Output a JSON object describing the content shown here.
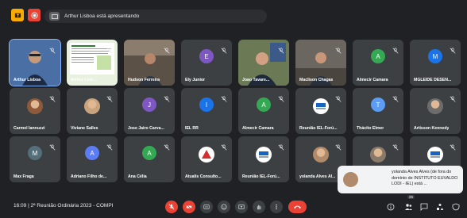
{
  "topbar": {
    "presenting_text": "Arthur Lisboa está apresentando"
  },
  "tiles": [
    {
      "name": "Arthur Lisboa",
      "kind": "video-arthur"
    },
    {
      "name": "Arthur Lisb...",
      "kind": "screen-share"
    },
    {
      "name": "Hudson Ferreira",
      "kind": "video-hudson"
    },
    {
      "name": "Ely Junior",
      "kind": "avatar",
      "letter": "E",
      "color": "#7e57c2"
    },
    {
      "name": "Joao Tavare...",
      "kind": "video-joao"
    },
    {
      "name": "Maclison Chagas",
      "kind": "video-maclison"
    },
    {
      "name": "Almecir Camara",
      "kind": "avatar",
      "letter": "A",
      "color": "#34a853"
    },
    {
      "name": "MGLEIDE DESEN...",
      "kind": "avatar",
      "letter": "M",
      "color": "#1a73e8"
    },
    {
      "name": "Carmel Iannuzzi",
      "kind": "photo",
      "color": "#8d5a3b"
    },
    {
      "name": "Viviane Salles",
      "kind": "photo",
      "color": "#c9a27e"
    },
    {
      "name": "Jose Jairo Carva...",
      "kind": "avatar",
      "letter": "J",
      "color": "#7e57c2"
    },
    {
      "name": "IEL RR",
      "kind": "avatar",
      "letter": "I",
      "color": "#1a73e8"
    },
    {
      "name": "Almecir Camara",
      "kind": "avatar",
      "letter": "A",
      "color": "#34a853"
    },
    {
      "name": "Reunião IEL-Forú...",
      "kind": "logo",
      "color": "#ffffff"
    },
    {
      "name": "Thácito Elmer",
      "kind": "avatar",
      "letter": "T",
      "color": "#5c9cf5"
    },
    {
      "name": "Artisson Kennedy",
      "kind": "photo",
      "color": "#6d6d6d"
    },
    {
      "name": "Max Fraga",
      "kind": "avatar",
      "letter": "M",
      "color": "#546e7a"
    },
    {
      "name": "Adriano Filho de...",
      "kind": "avatar",
      "letter": "A",
      "color": "#5c7cf5"
    },
    {
      "name": "Ana Célia",
      "kind": "avatar",
      "letter": "A",
      "color": "#34a853"
    },
    {
      "name": "Atualis Consulto...",
      "kind": "logo-red",
      "color": "#ffffff"
    },
    {
      "name": "Reunião IEL-Forú...",
      "kind": "logo",
      "color": "#ffffff"
    },
    {
      "name": "yolanda Alves Al...",
      "kind": "photo",
      "color": "#b08a6a"
    },
    {
      "name": "",
      "kind": "photo-group",
      "color": "#8a7a6a"
    },
    {
      "name": "",
      "kind": "logo",
      "color": "#ffffff"
    }
  ],
  "toast": {
    "text": "yolanda Alves Alves (de fora do domínio de INSTITUTO EUVALDO LODI - IEL) está ..."
  },
  "bottombar": {
    "meeting_info": "16:09  |  2ª Reunião Ordinária 2023 - COMPI",
    "participants_badge": "26"
  },
  "colors": {
    "background": "#202124",
    "tile": "#3c4043",
    "danger": "#ea4335",
    "accent": "#f9ab00"
  }
}
